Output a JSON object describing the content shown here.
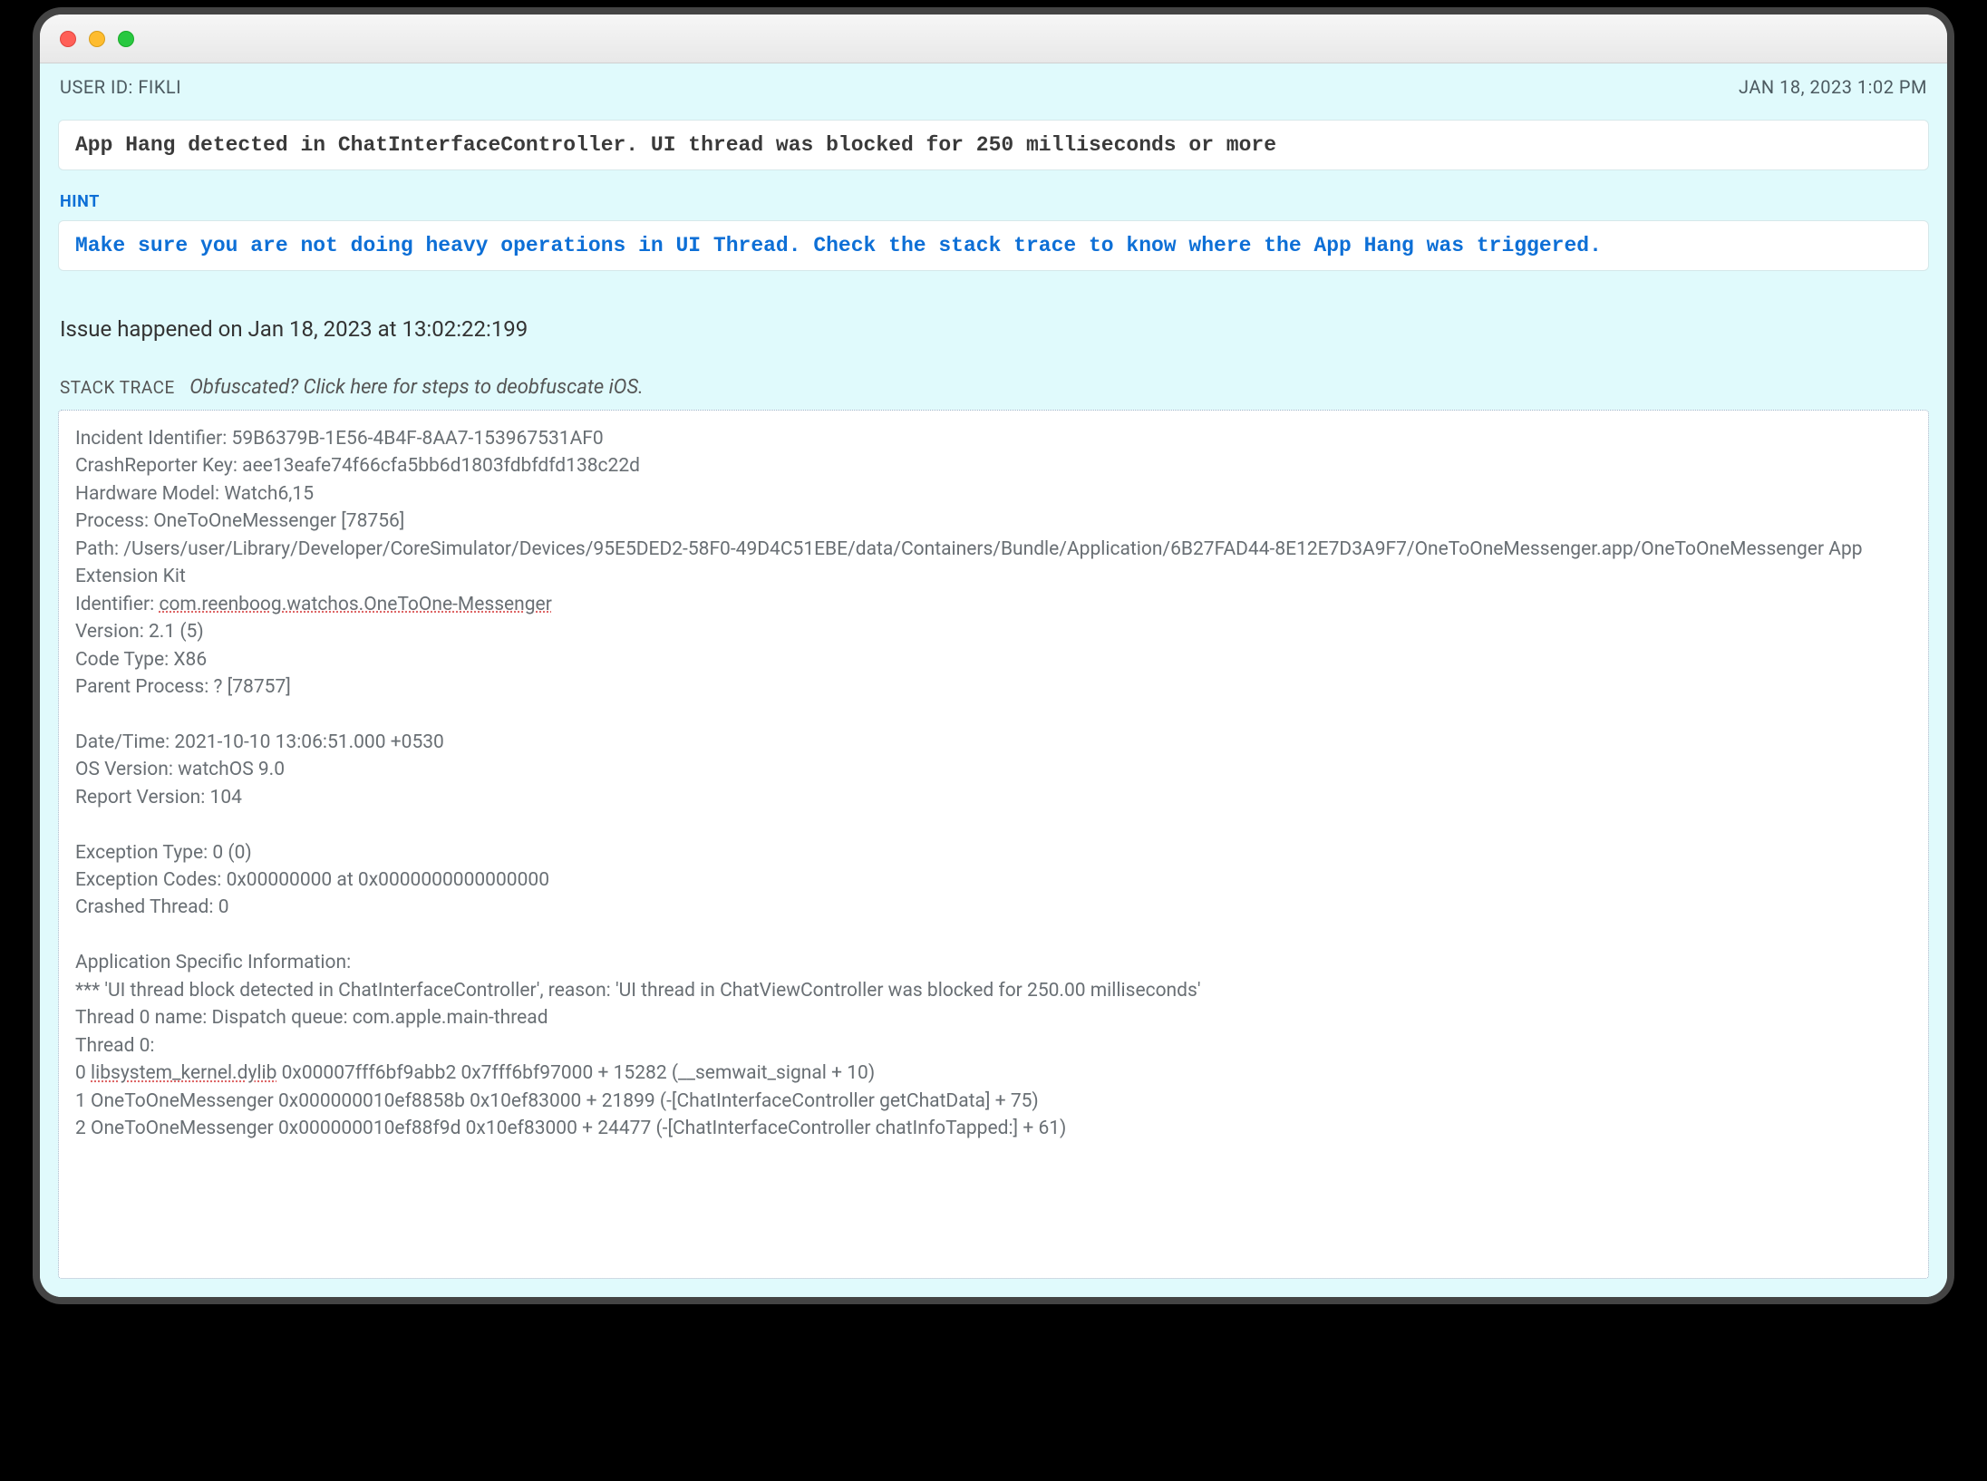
{
  "header": {
    "user_id_label": "USER ID: FIKLI",
    "timestamp": "JAN 18, 2023 1:02 PM"
  },
  "error_message": "App Hang detected in ChatInterfaceController. UI thread was blocked for 250 milliseconds or more",
  "hint_label": "HINT",
  "hint_text": "Make sure you are not doing heavy operations in UI Thread. Check the stack trace to know where the App Hang was triggered.",
  "issue_line": "Issue happened on Jan 18, 2023 at 13:02:22:199",
  "stack": {
    "label": "STACK TRACE",
    "deobfuscate_link": "Obfuscated? Click here for steps to deobfuscate iOS.",
    "lines": {
      "l1": "Incident Identifier: 59B6379B-1E56-4B4F-8AA7-153967531AF0",
      "l2": "CrashReporter Key: aee13eafe74f66cfa5bb6d1803fdbfdfd138c22d",
      "l3": "Hardware Model: Watch6,15",
      "l4": "Process: OneToOneMessenger [78756]",
      "l5": "Path: /Users/user/Library/Developer/CoreSimulator/Devices/95E5DED2-58F0-49D4C51EBE/data/Containers/Bundle/Application/6B27FAD44-8E12E7D3A9F7/OneToOneMessenger.app/OneToOneMessenger App Extension Kit",
      "l6a": "Identifier: ",
      "l6b": "com.reenboog.watchos.OneToOne-Messenger",
      "l7": "Version: 2.1 (5)",
      "l8": "Code Type: X86",
      "l9": "Parent Process: ? [78757]",
      "l10": "Date/Time: 2021-10-10 13:06:51.000 +0530",
      "l11": "OS Version: watchOS 9.0",
      "l12": "Report Version: 104",
      "l13": "Exception Type: 0 (0)",
      "l14": "Exception Codes: 0x00000000 at 0x0000000000000000",
      "l15": "Crashed Thread: 0",
      "l16": "Application Specific Information:",
      "l17": "*** 'UI thread block detected in ChatInterfaceController', reason: 'UI thread in ChatViewController was blocked for 250.00 milliseconds'",
      "l18": "Thread 0 name: Dispatch queue: com.apple.main-thread",
      "l19": "Thread 0:",
      "l20a": "0 ",
      "l20b": "libsystem_kernel.dylib",
      "l20c": " 0x00007fff6bf9abb2 0x7fff6bf97000 + 15282 (__semwait_signal + 10)",
      "l21": "1 OneToOneMessenger 0x000000010ef8858b 0x10ef83000 + 21899 (-[ChatInterfaceController getChatData] + 75)",
      "l22": "2 OneToOneMessenger 0x000000010ef88f9d 0x10ef83000 + 24477 (-[ChatInterfaceController chatInfoTapped:] + 61)"
    }
  }
}
